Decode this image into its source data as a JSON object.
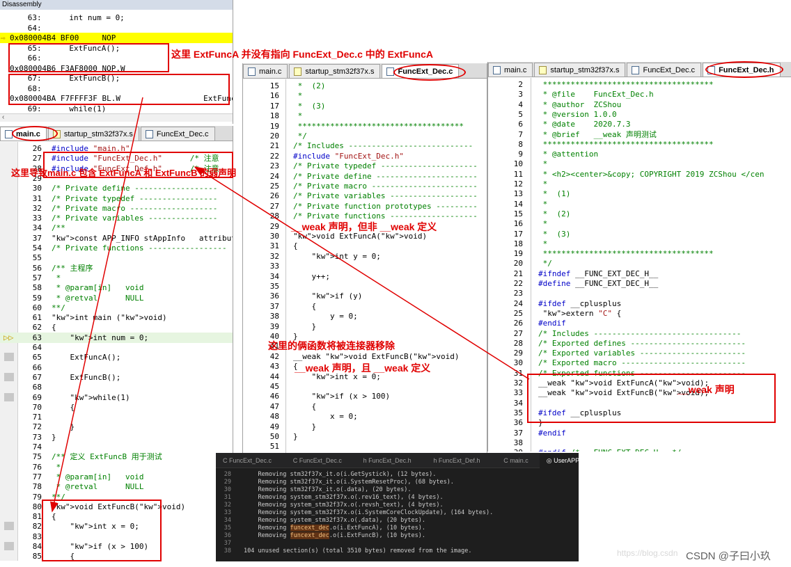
{
  "disassembly": {
    "title": "Disassembly",
    "lines": [
      {
        "ln": "63:",
        "code": "    int num = 0;"
      },
      {
        "ln": "64:",
        "code": ""
      },
      {
        "addr": "0x080004B4",
        "op": "BF00",
        "ins": "NOP",
        "current": true
      },
      {
        "ln": "65:",
        "code": "    ExtFuncA();"
      },
      {
        "ln": "66:",
        "code": ""
      },
      {
        "addr": "0x080004B6",
        "op": "F3AF8000",
        "ins": "NOP.W"
      },
      {
        "ln": "67:",
        "code": "    ExtFuncB();"
      },
      {
        "ln": "68:",
        "code": ""
      },
      {
        "addr": "0x080004BA",
        "op": "F7FFFF3F",
        "ins": "BL.W",
        "target": "ExtFuncB"
      },
      {
        "ln": "69:",
        "code": "    while(1)"
      }
    ]
  },
  "annotations": {
    "a1": "这里 ExtFuncA 并没有指向 FuncExt_Dec.c 中的 ExtFuncA",
    "a2": "这里导致main.c 包含 ExtFuncA 和 ExtFuncB 的弱声明",
    "a3": "__weak 声明，但非 __weak 定义",
    "a4": "这里的俩函数将被连接器移除",
    "a5": "__weak 声明，且 __weak 定义",
    "a6": "__weak 声明"
  },
  "left_editor": {
    "tabs": [
      "main.c",
      "startup_stm32f37x.s",
      "FuncExt_Dec.c"
    ],
    "lines": [
      {
        "n": "26",
        "t": "#include \"main.h\""
      },
      {
        "n": "27",
        "t": "#include \"FuncExt_Dec.h\"      /* 注意"
      },
      {
        "n": "28",
        "t": "#include \"FuncExt_Def.h\"      /* 注意"
      },
      {
        "n": "29",
        "t": ""
      },
      {
        "n": "30",
        "t": "/* Private define ------------------"
      },
      {
        "n": "31",
        "t": "/* Private typedef -----------------"
      },
      {
        "n": "32",
        "t": "/* Private macro -------------------"
      },
      {
        "n": "33",
        "t": "/* Private variables ---------------"
      },
      {
        "n": "34",
        "t": "/**"
      },
      {
        "n": "37",
        "t": "const APP_INFO stAppInfo   attribute"
      },
      {
        "n": "54",
        "t": "/* Private functions -----------------"
      },
      {
        "n": "55",
        "t": ""
      },
      {
        "n": "56",
        "t": "/** 主程序"
      },
      {
        "n": "57",
        "t": " *"
      },
      {
        "n": "58",
        "t": " * @param[in]   void"
      },
      {
        "n": "59",
        "t": " * @retval      NULL"
      },
      {
        "n": "60",
        "t": "**/"
      },
      {
        "n": "61",
        "t": "int main (void)"
      },
      {
        "n": "62",
        "t": "{"
      },
      {
        "n": "63",
        "t": "    int num = 0;"
      },
      {
        "n": "64",
        "t": ""
      },
      {
        "n": "65",
        "t": "    ExtFuncA();"
      },
      {
        "n": "66",
        "t": ""
      },
      {
        "n": "67",
        "t": "    ExtFuncB();"
      },
      {
        "n": "68",
        "t": ""
      },
      {
        "n": "69",
        "t": "    while(1)"
      },
      {
        "n": "70",
        "t": "    {"
      },
      {
        "n": "71",
        "t": ""
      },
      {
        "n": "72",
        "t": "    }"
      },
      {
        "n": "73",
        "t": "}"
      },
      {
        "n": "74",
        "t": ""
      },
      {
        "n": "75",
        "t": "/** 定义 ExtFuncB 用于测试"
      },
      {
        "n": "76",
        "t": " *"
      },
      {
        "n": "77",
        "t": " * @param[in]   void"
      },
      {
        "n": "78",
        "t": " * @retval      NULL"
      },
      {
        "n": "79",
        "t": "**/"
      },
      {
        "n": "80",
        "t": "void ExtFuncB(void)"
      },
      {
        "n": "81",
        "t": "{"
      },
      {
        "n": "82",
        "t": "    int x = 0;"
      },
      {
        "n": "83",
        "t": ""
      },
      {
        "n": "84",
        "t": "    if (x > 100)"
      },
      {
        "n": "85",
        "t": "    {"
      }
    ]
  },
  "mid_editor": {
    "tabs": [
      "main.c",
      "startup_stm32f37x.s",
      "FuncExt_Dec.c"
    ],
    "lines": [
      {
        "n": "15",
        "t": " *  (2)"
      },
      {
        "n": "16",
        "t": " *"
      },
      {
        "n": "17",
        "t": " *  (3)"
      },
      {
        "n": "18",
        "t": " *"
      },
      {
        "n": "19",
        "t": " ************************************"
      },
      {
        "n": "20",
        "t": " */"
      },
      {
        "n": "21",
        "t": "/* Includes ---------------------------"
      },
      {
        "n": "22",
        "t": "#include \"FuncExt_Dec.h\""
      },
      {
        "n": "23",
        "t": "/* Private typedef ---------------------"
      },
      {
        "n": "24",
        "t": "/* Private define ----------------------"
      },
      {
        "n": "25",
        "t": "/* Private macro -----------------------"
      },
      {
        "n": "26",
        "t": "/* Private variables -------------------"
      },
      {
        "n": "27",
        "t": "/* Private function prototypes ---------"
      },
      {
        "n": "28",
        "t": "/* Private functions -------------------"
      },
      {
        "n": "29",
        "t": ""
      },
      {
        "n": "30",
        "t": "void ExtFuncA(void)"
      },
      {
        "n": "31",
        "t": "{"
      },
      {
        "n": "32",
        "t": "    int y = 0;"
      },
      {
        "n": "33",
        "t": ""
      },
      {
        "n": "34",
        "t": "    y++;"
      },
      {
        "n": "35",
        "t": ""
      },
      {
        "n": "36",
        "t": "    if (y)"
      },
      {
        "n": "37",
        "t": "    {"
      },
      {
        "n": "38",
        "t": "        y = 0;"
      },
      {
        "n": "39",
        "t": "    }"
      },
      {
        "n": "40",
        "t": "}"
      },
      {
        "n": "41",
        "t": ""
      },
      {
        "n": "42",
        "t": "__weak void ExtFuncB(void)"
      },
      {
        "n": "43",
        "t": "{"
      },
      {
        "n": "44",
        "t": "    int x = 0;"
      },
      {
        "n": "45",
        "t": ""
      },
      {
        "n": "46",
        "t": "    if (x > 100)"
      },
      {
        "n": "47",
        "t": "    {"
      },
      {
        "n": "48",
        "t": "        x = 0;"
      },
      {
        "n": "49",
        "t": "    }"
      },
      {
        "n": "50",
        "t": "}"
      },
      {
        "n": "51",
        "t": ""
      }
    ]
  },
  "right_editor": {
    "tabs": [
      "main.c",
      "startup_stm32f37x.s",
      "FuncExt_Dec.c",
      "FuncExt_Dec.h"
    ],
    "lines": [
      {
        "n": "2",
        "t": " *************************************"
      },
      {
        "n": "3",
        "t": " * @file    FuncExt_Dec.h"
      },
      {
        "n": "4",
        "t": " * @author  ZCShou"
      },
      {
        "n": "5",
        "t": " * @version 1.0.0"
      },
      {
        "n": "6",
        "t": " * @date    2020.7.3"
      },
      {
        "n": "7",
        "t": " * @brief   __weak 声明测试"
      },
      {
        "n": "8",
        "t": " *************************************"
      },
      {
        "n": "9",
        "t": " * @attention"
      },
      {
        "n": "10",
        "t": " *"
      },
      {
        "n": "11",
        "t": " * <h2><center>&copy; COPYRIGHT 2019 ZCShou </cen"
      },
      {
        "n": "12",
        "t": " *"
      },
      {
        "n": "13",
        "t": " *  (1)"
      },
      {
        "n": "14",
        "t": " *"
      },
      {
        "n": "15",
        "t": " *  (2)"
      },
      {
        "n": "16",
        "t": " *"
      },
      {
        "n": "17",
        "t": " *  (3)"
      },
      {
        "n": "18",
        "t": " *"
      },
      {
        "n": "19",
        "t": " *************************************"
      },
      {
        "n": "20",
        "t": " */"
      },
      {
        "n": "21",
        "t": "#ifndef __FUNC_EXT_DEC_H__"
      },
      {
        "n": "22",
        "t": "#define __FUNC_EXT_DEC_H__"
      },
      {
        "n": "23",
        "t": ""
      },
      {
        "n": "24",
        "t": "#ifdef __cplusplus"
      },
      {
        "n": "25",
        "t": " extern \"C\" {"
      },
      {
        "n": "26",
        "t": "#endif"
      },
      {
        "n": "27",
        "t": "/* Includes --------------------------------"
      },
      {
        "n": "28",
        "t": "/* Exported defines -------------------------"
      },
      {
        "n": "29",
        "t": "/* Exported variables -----------------------"
      },
      {
        "n": "30",
        "t": "/* Exported macro ---------------------------"
      },
      {
        "n": "31",
        "t": "/* Exported functions -----------------------"
      },
      {
        "n": "32",
        "t": "__weak void ExtFuncA(void);"
      },
      {
        "n": "33",
        "t": "__weak void ExtFuncB(void);"
      },
      {
        "n": "34",
        "t": ""
      },
      {
        "n": "35",
        "t": "#ifdef __cplusplus"
      },
      {
        "n": "36",
        "t": "}"
      },
      {
        "n": "37",
        "t": "#endif"
      },
      {
        "n": "38",
        "t": ""
      },
      {
        "n": "39",
        "t": "#endif /* __FUNC_EXT_DEC_H__ */"
      }
    ]
  },
  "map_view": {
    "tabs": [
      "FuncExt_Dec.c",
      "FuncExt_Dec.c",
      "FuncExt_Dec.h",
      "FuncExt_Def.h",
      "main.c",
      "UserAPP.map"
    ],
    "active_tab": "UserAPP.map",
    "lines": [
      {
        "n": "28",
        "t": "    Removing stm32f37x_it.o(i.GetSystick), (12 bytes)."
      },
      {
        "n": "29",
        "t": "    Removing stm32f37x_it.o(i.SystemResetProc), (68 bytes)."
      },
      {
        "n": "30",
        "t": "    Removing stm32f37x_it.o(.data), (20 bytes)."
      },
      {
        "n": "31",
        "t": "    Removing system_stm32f37x.o(.rev16_text), (4 bytes)."
      },
      {
        "n": "32",
        "t": "    Removing system_stm32f37x.o(.revsh_text), (4 bytes)."
      },
      {
        "n": "33",
        "t": "    Removing system_stm32f37x.o(i.SystemCoreClockUpdate), (164 bytes)."
      },
      {
        "n": "34",
        "t": "    Removing system_stm32f37x.o(.data), (20 bytes)."
      },
      {
        "n": "35",
        "t": "    Removing funcext_dec.o(i.ExtFuncA), (10 bytes).",
        "hl": "funcext_dec"
      },
      {
        "n": "36",
        "t": "    Removing funcext_dec.o(i.ExtFuncB), (10 bytes).",
        "hl": "funcext_dec"
      },
      {
        "n": "37",
        "t": ""
      },
      {
        "n": "38",
        "t": "104 unused section(s) (total 3510 bytes) removed from the image."
      }
    ]
  },
  "watermark": "CSDN @子曰小玖",
  "watermark_faint": "https://blog.csdn"
}
